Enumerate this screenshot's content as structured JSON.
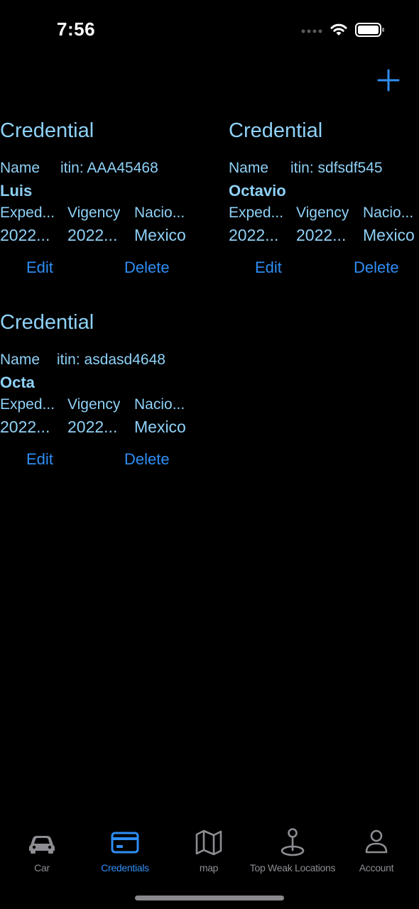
{
  "status_bar": {
    "time": "7:56",
    "signal_icon": "cellular-dots-icon",
    "wifi_icon": "wifi-icon",
    "battery_icon": "battery-icon"
  },
  "header": {
    "add_icon": "plus-icon"
  },
  "credentials": [
    {
      "title": "Credential",
      "name_label": "Name",
      "itin": "itin: AAA45468",
      "name": "Luis",
      "headers": [
        "Exped...",
        "Vigency",
        "Nacio..."
      ],
      "values": [
        "2022...",
        "2022...",
        "Mexico"
      ],
      "edit_label": "Edit",
      "delete_label": "Delete"
    },
    {
      "title": "Credential",
      "name_label": "Name",
      "itin": "itin: sdfsdf545",
      "name": "Octavio",
      "headers": [
        "Exped...",
        "Vigency",
        "Nacio..."
      ],
      "values": [
        "2022...",
        "2022...",
        "Mexico"
      ],
      "edit_label": "Edit",
      "delete_label": "Delete"
    },
    {
      "title": "Credential",
      "name_label": "Name",
      "itin": "itin: asdasd4648",
      "name": "Octa",
      "headers": [
        "Exped...",
        "Vigency",
        "Nacio..."
      ],
      "values": [
        "2022...",
        "2022...",
        "Mexico"
      ],
      "edit_label": "Edit",
      "delete_label": "Delete"
    }
  ],
  "tab_bar": {
    "active_color": "#2f8ef5",
    "inactive_color": "#8d8d93",
    "tabs": [
      {
        "label": "Car",
        "icon": "car-icon",
        "active": false
      },
      {
        "label": "Credentials",
        "icon": "credit-card-icon",
        "active": true
      },
      {
        "label": "map",
        "icon": "map-icon",
        "active": false
      },
      {
        "label": "Top Weak Locations",
        "icon": "map-pin-icon",
        "active": false
      },
      {
        "label": "Account",
        "icon": "person-icon",
        "active": false
      }
    ]
  },
  "colors": {
    "background": "#000000",
    "card_text": "#8fd1f7",
    "accent": "#2f8ef5"
  }
}
